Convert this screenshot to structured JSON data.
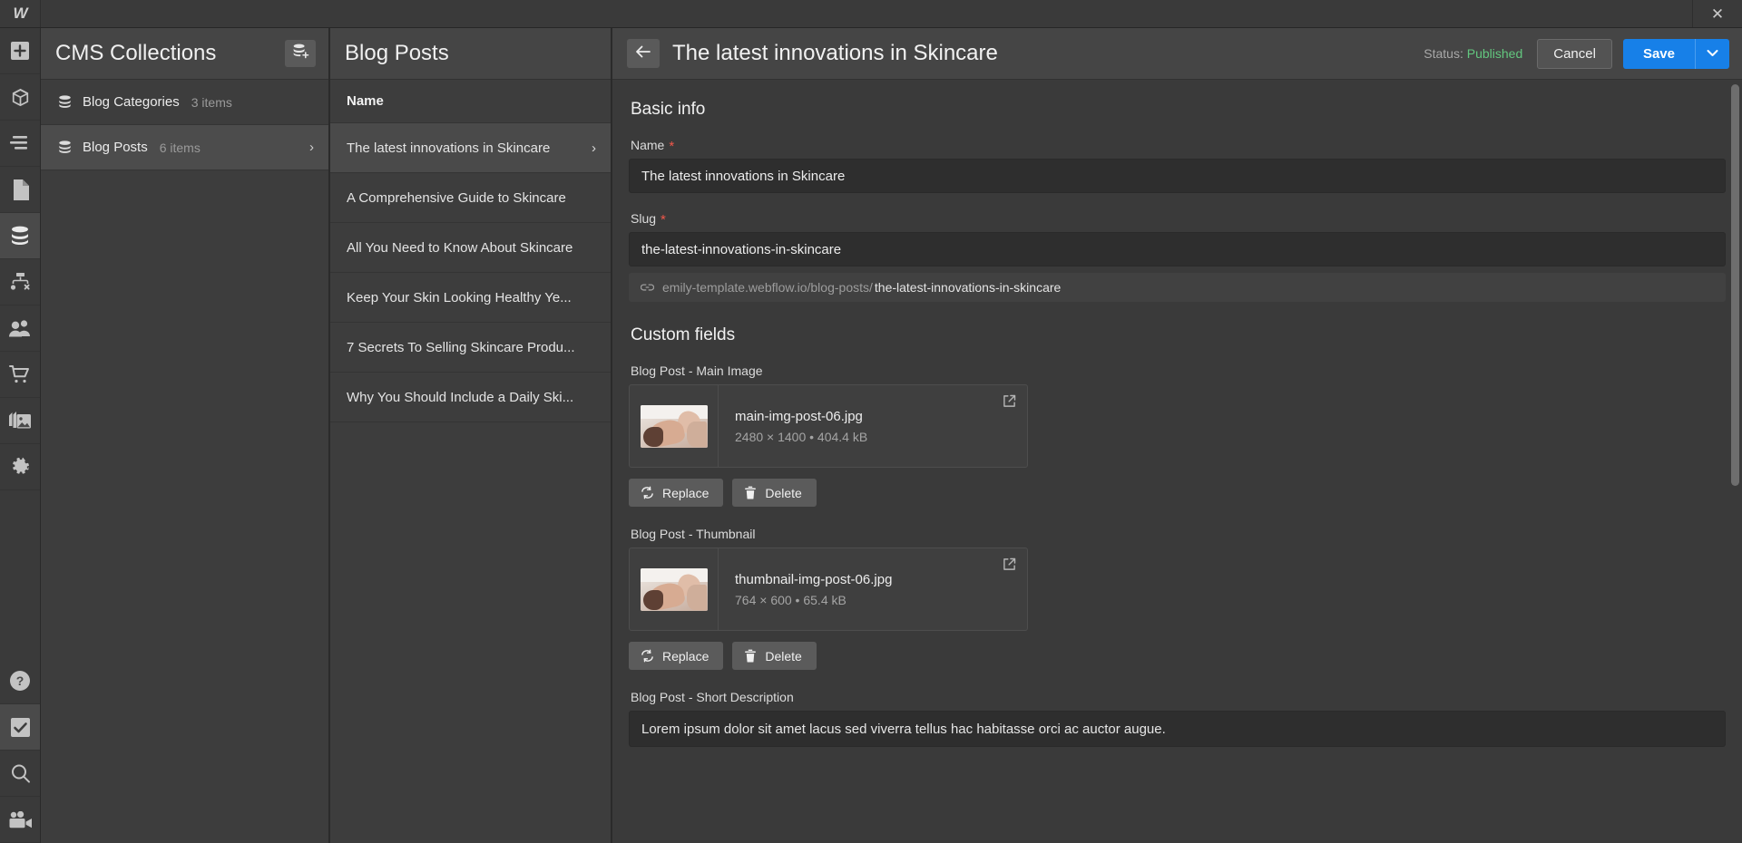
{
  "topbar": {
    "logo": "W",
    "close_label": "✕"
  },
  "rail": {
    "items": [
      {
        "name": "add-element",
        "icon": "plus-icon",
        "active": false
      },
      {
        "name": "components",
        "icon": "cube-icon",
        "active": false
      },
      {
        "name": "navigator",
        "icon": "list-icon",
        "active": false
      },
      {
        "name": "pages",
        "icon": "page-icon",
        "active": false
      },
      {
        "name": "cms",
        "icon": "database-icon",
        "active": true
      },
      {
        "name": "logic",
        "icon": "logic-icon",
        "active": false
      },
      {
        "name": "users",
        "icon": "users-icon",
        "active": false
      },
      {
        "name": "ecommerce",
        "icon": "cart-icon",
        "active": false
      },
      {
        "name": "assets",
        "icon": "images-icon",
        "active": false
      },
      {
        "name": "settings",
        "icon": "gear-icon",
        "active": false
      }
    ],
    "bottom_items": [
      {
        "name": "help",
        "icon": "question-circle-icon"
      },
      {
        "name": "audit",
        "icon": "checkmark-icon",
        "active": true
      },
      {
        "name": "search",
        "icon": "search-icon"
      },
      {
        "name": "video",
        "icon": "video-camera-icon"
      }
    ]
  },
  "collections": {
    "title": "CMS Collections",
    "add_button_icon": "database-plus-icon",
    "items": [
      {
        "name": "Blog Categories",
        "count": "3 items",
        "selected": false,
        "chevron": false
      },
      {
        "name": "Blog Posts",
        "count": "6 items",
        "selected": true,
        "chevron": true
      }
    ]
  },
  "itemlist": {
    "title": "Blog Posts",
    "column_header": "Name",
    "rows": [
      {
        "name": "The latest innovations in Skincare",
        "selected": true
      },
      {
        "name": "A Comprehensive Guide to Skincare",
        "selected": false
      },
      {
        "name": "All You Need to Know About Skincare",
        "selected": false
      },
      {
        "name": "Keep Your Skin Looking Healthy Ye...",
        "selected": false
      },
      {
        "name": "7 Secrets To Selling Skincare Produ...",
        "selected": false
      },
      {
        "name": "Why You Should Include a Daily Ski...",
        "selected": false
      }
    ]
  },
  "editor": {
    "back_icon": "arrow-left-icon",
    "title": "The latest innovations in Skincare",
    "status_label": "Status:",
    "status_value": "Published",
    "status_color": "#63c77f",
    "cancel_label": "Cancel",
    "save_label": "Save",
    "save_caret_icon": "chevron-down-icon",
    "accent_color": "#1780e8",
    "basic_info": {
      "heading": "Basic info",
      "name_label": "Name",
      "name_required": "*",
      "name_value": "The latest innovations in Skincare",
      "slug_label": "Slug",
      "slug_required": "*",
      "slug_value": "the-latest-innovations-in-skincare",
      "slug_hint_icon": "link-icon",
      "slug_hint_prefix": "emily-template.webflow.io/blog-posts/",
      "slug_hint_slug": "the-latest-innovations-in-skincare"
    },
    "custom_fields": {
      "heading": "Custom fields",
      "main_image": {
        "label": "Blog Post - Main Image",
        "file_name": "main-img-post-06.jpg",
        "file_meta": "2480 × 1400 • 404.4 kB",
        "open_icon": "external-link-icon",
        "replace_label": "Replace",
        "replace_icon": "refresh-icon",
        "delete_label": "Delete",
        "delete_icon": "trash-icon"
      },
      "thumbnail": {
        "label": "Blog Post - Thumbnail",
        "file_name": "thumbnail-img-post-06.jpg",
        "file_meta": "764 × 600 • 65.4 kB",
        "open_icon": "external-link-icon",
        "replace_label": "Replace",
        "replace_icon": "refresh-icon",
        "delete_label": "Delete",
        "delete_icon": "trash-icon"
      },
      "short_description": {
        "label": "Blog Post - Short Description",
        "value": "Lorem ipsum dolor sit amet lacus sed viverra tellus hac habitasse orci ac auctor augue."
      }
    }
  }
}
